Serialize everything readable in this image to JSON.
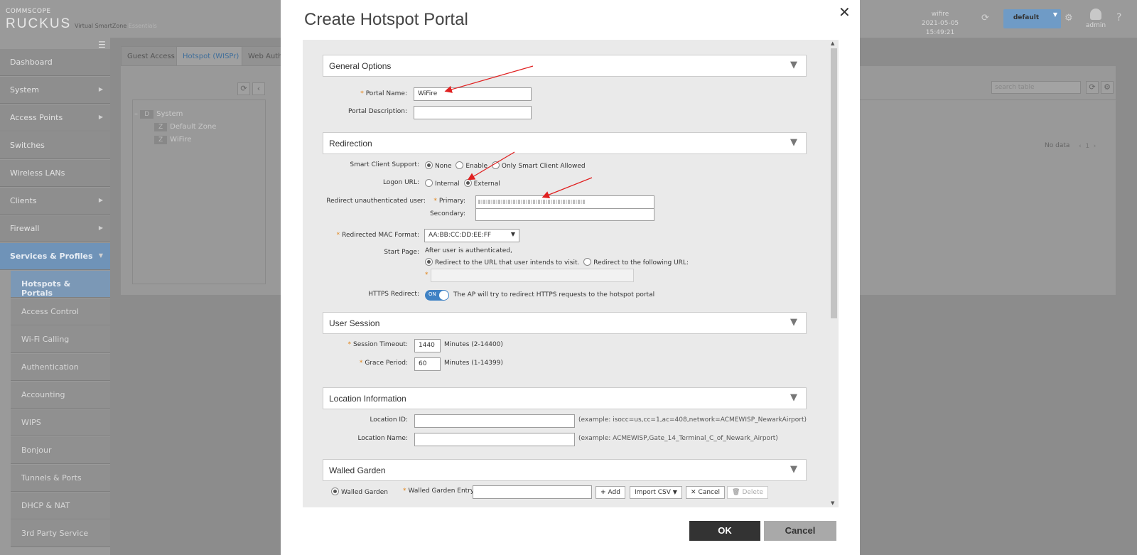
{
  "app": {
    "logo_small": "COMMSCOPE",
    "logo_main": "RUCKUS",
    "logo_sub": "Virtual SmartZone",
    "logo_edition": "Essentials",
    "host": "wifire",
    "datetime": "2021-05-05  15:49:21",
    "domain": "default",
    "user": "admin"
  },
  "sidebar": {
    "items": [
      {
        "label": "Dashboard"
      },
      {
        "label": "System",
        "arrow": "▶"
      },
      {
        "label": "Access Points",
        "arrow": "▶"
      },
      {
        "label": "Switches"
      },
      {
        "label": "Wireless LANs"
      },
      {
        "label": "Clients",
        "arrow": "▶"
      },
      {
        "label": "Firewall",
        "arrow": "▶"
      },
      {
        "label": "Services & Profiles",
        "arrow": "▼"
      }
    ],
    "subitems": [
      "Hotspots & Portals",
      "Access Control",
      "Wi-Fi Calling",
      "Authentication",
      "Accounting",
      "WIPS",
      "Bonjour",
      "Tunnels & Ports",
      "DHCP & NAT",
      "3rd Party Service"
    ]
  },
  "background": {
    "tabs": [
      "Guest Access",
      "Hotspot (WISPr)",
      "Web Auth"
    ],
    "tree": [
      {
        "badge": "D",
        "label": "System"
      },
      {
        "badge": "Z",
        "label": "Default Zone"
      },
      {
        "badge": "Z",
        "label": "WiFire"
      }
    ],
    "search_placeholder": "search table",
    "no_data": "No data",
    "page": "1"
  },
  "modal": {
    "title": "Create Hotspot Portal",
    "close": "✕",
    "sections": {
      "general": "General Options",
      "redirection": "Redirection",
      "session": "User Session",
      "location": "Location Information",
      "walled": "Walled Garden"
    },
    "general": {
      "portal_name_label": "Portal Name:",
      "portal_name_value": "WiFire",
      "portal_desc_label": "Portal Description:",
      "portal_desc_value": ""
    },
    "redirection": {
      "smart_client_label": "Smart Client Support:",
      "smart_client_options": [
        "None",
        "Enable",
        "Only Smart Client Allowed"
      ],
      "logon_url_label": "Logon URL:",
      "logon_url_options": [
        "Internal",
        "External"
      ],
      "redirect_label": "Redirect unauthenticated user:",
      "primary_label": "Primary:",
      "secondary_label": "Secondary:",
      "secondary_value": "",
      "mac_format_label": "Redirected MAC Format:",
      "mac_format_value": "AA:BB:CC:DD:EE:FF",
      "start_page_label": "Start Page:",
      "start_page_text": "After user is authenticated,",
      "start_page_options": [
        "Redirect to the URL that user intends to visit.",
        "Redirect to the following URL:"
      ],
      "https_label": "HTTPS Redirect:",
      "https_toggle": "ON",
      "https_desc": "The AP will try to redirect HTTPS requests to the hotspot portal"
    },
    "session": {
      "timeout_label": "Session Timeout:",
      "timeout_value": "1440",
      "timeout_unit": "Minutes (2-14400)",
      "grace_label": "Grace Period:",
      "grace_value": "60",
      "grace_unit": "Minutes (1-14399)"
    },
    "location": {
      "id_label": "Location ID:",
      "id_value": "",
      "id_example": "(example: isocc=us,cc=1,ac=408,network=ACMEWISP_NewarkAirport)",
      "name_label": "Location Name:",
      "name_value": "",
      "name_example": "(example: ACMEWISP,Gate_14_Terminal_C_of_Newark_Airport)"
    },
    "walled": {
      "radio_label": "Walled Garden",
      "entry_label": "Walled Garden Entry",
      "entry_value": "",
      "add": "Add",
      "import": "Import CSV",
      "cancel": "Cancel",
      "delete": "Delete"
    },
    "ok": "OK",
    "cancel": "Cancel"
  },
  "colors": {
    "accent": "#3f82c4",
    "required": "#e28419",
    "annotation_arrow": "#e02020"
  }
}
